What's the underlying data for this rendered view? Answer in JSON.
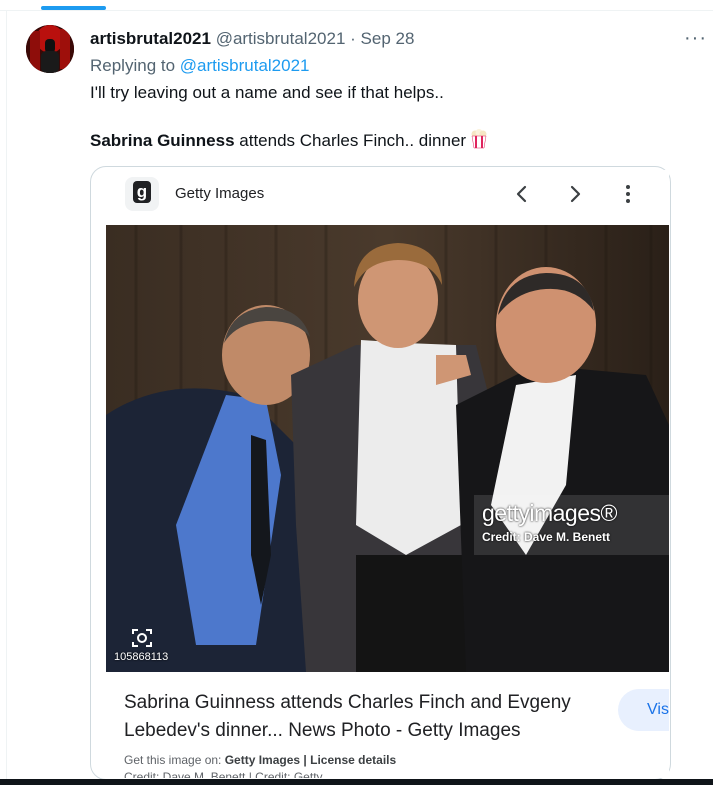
{
  "tweet": {
    "display_name": "artisbrutal2021",
    "handle": "@artisbrutal2021",
    "separator": "·",
    "date": "Sep 28",
    "replying_prefix": "Replying to ",
    "replying_to": "@artisbrutal2021",
    "text": "I'll try leaving out a name and see if that helps..",
    "line2_bold": "Sabrina Guinness",
    "line2_rest": " attends Charles Finch.. dinner",
    "emoji_icon": "popcorn-icon",
    "more_label": "···"
  },
  "embed": {
    "source_name": "Getty Images",
    "result_title": "Sabrina Guinness attends Charles Finch and Evgeny Lebedev's dinner... News Photo - Getty Images",
    "visit_label": "Visit",
    "get_image_prefix": "Get this image on: ",
    "get_image_source": "Getty Images",
    "get_image_sep": " | ",
    "license": "License details",
    "credit_cutoff": "Credit: Dave M. Benett | Credit: Getty..."
  },
  "photo": {
    "watermark_logo": "gettyimages®",
    "watermark_credit": "Credit: Dave M. Benett",
    "image_id": "105868113"
  },
  "colors": {
    "accent": "#1d9bf0",
    "text_primary": "#0f1419",
    "text_secondary": "#536471",
    "border": "#cfd9de",
    "visit_bg": "#e8f0fe",
    "visit_text": "#1a73e8"
  }
}
